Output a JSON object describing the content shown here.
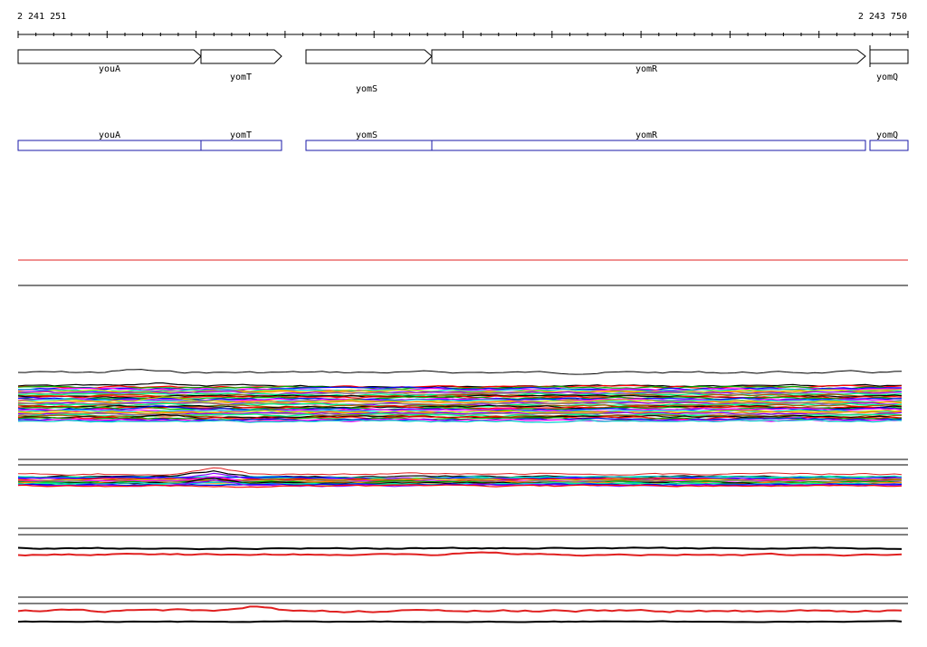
{
  "coordinates": {
    "start": "2 241 251",
    "end": "2 243 750"
  },
  "genes": [
    {
      "name": "youA"
    },
    {
      "name": "yomT"
    },
    {
      "name": "yomS"
    },
    {
      "name": "yomR"
    },
    {
      "name": "yomQ"
    }
  ],
  "colors": {
    "arrow": "#000000",
    "annotation_box": "#1a1aa8",
    "reference_line": "#e02020",
    "track_palette": [
      "#000000",
      "#ff0000",
      "#00aa00",
      "#0000ff",
      "#ff00ff",
      "#00cccc",
      "#cccc00",
      "#ff8800",
      "#8800ff",
      "#888888",
      "#00ff88",
      "#aa5500"
    ]
  }
}
